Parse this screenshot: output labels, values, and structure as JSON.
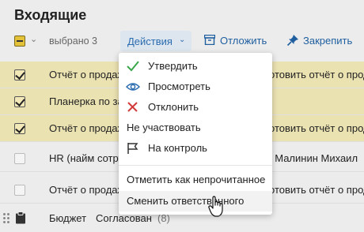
{
  "header": {
    "title": "Входящие"
  },
  "toolbar": {
    "selected_label": "выбрано 3",
    "actions_label": "Действия",
    "postpone_label": "Отложить",
    "pin_label": "Закрепить"
  },
  "rows": [
    {
      "subject": "Отчёт о продаж",
      "preview": "отовить отчёт о прод",
      "checked": true
    },
    {
      "subject": "Планерка по за",
      "preview": "",
      "checked": true
    },
    {
      "subject": "Отчёт о продаж",
      "preview": "отовить отчёт о прод",
      "checked": true
    },
    {
      "subject": "HR (найм сотру",
      "preview": "; Малинин Михаил",
      "checked": false
    },
    {
      "subject": "Отчёт о продаж",
      "preview": "отовить отчёт о прод",
      "checked": false
    }
  ],
  "last_row": {
    "subject": "Бюджет",
    "status": "Согласован",
    "count": "(8)"
  },
  "menu": {
    "items": [
      {
        "label": "Утвердить",
        "icon": "check-icon"
      },
      {
        "label": "Просмотреть",
        "icon": "eye-icon"
      },
      {
        "label": "Отклонить",
        "icon": "x-icon"
      },
      {
        "label": "Не участвовать",
        "icon": ""
      },
      {
        "label": "На контроль",
        "icon": "flag-icon"
      },
      {
        "label": "Отметить как непрочитанное",
        "icon": ""
      },
      {
        "label": "Сменить ответственного",
        "icon": ""
      }
    ]
  },
  "colors": {
    "accent": "#2b6cb0",
    "selected_row": "#ebe2b2",
    "approve_green": "#3aa64a",
    "reject_red": "#d33a3a"
  }
}
